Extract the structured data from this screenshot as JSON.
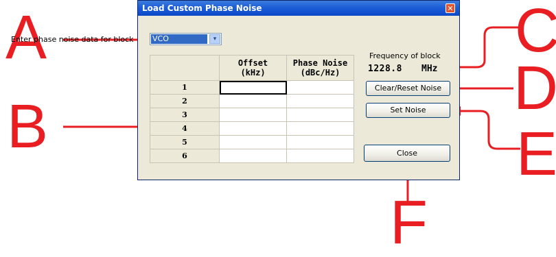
{
  "dialog": {
    "title": "Load Custom Phase Noise",
    "close_glyph": "✕"
  },
  "block_selector": {
    "label": "Enter phase noise data for block",
    "value": "VCO",
    "arrow_glyph": "▾"
  },
  "table": {
    "headers": [
      "Offset\n(kHz)",
      "Phase Noise\n(dBc/Hz)"
    ],
    "rows": [
      "1",
      "2",
      "3",
      "4",
      "5",
      "6"
    ],
    "cells": [
      [
        "",
        ""
      ],
      [
        "",
        ""
      ],
      [
        "",
        ""
      ],
      [
        "",
        ""
      ],
      [
        "",
        ""
      ],
      [
        "",
        ""
      ]
    ]
  },
  "frequency": {
    "label": "Frequency of block",
    "value": "1228.8",
    "unit": "MHz"
  },
  "buttons": {
    "clear_reset": "Clear/Reset Noise",
    "set_noise": "Set Noise",
    "close": "Close"
  },
  "annotations": {
    "A": "A",
    "B": "B",
    "C": "C",
    "D": "D",
    "E": "E",
    "F": "F",
    "color": "#e81e22"
  }
}
